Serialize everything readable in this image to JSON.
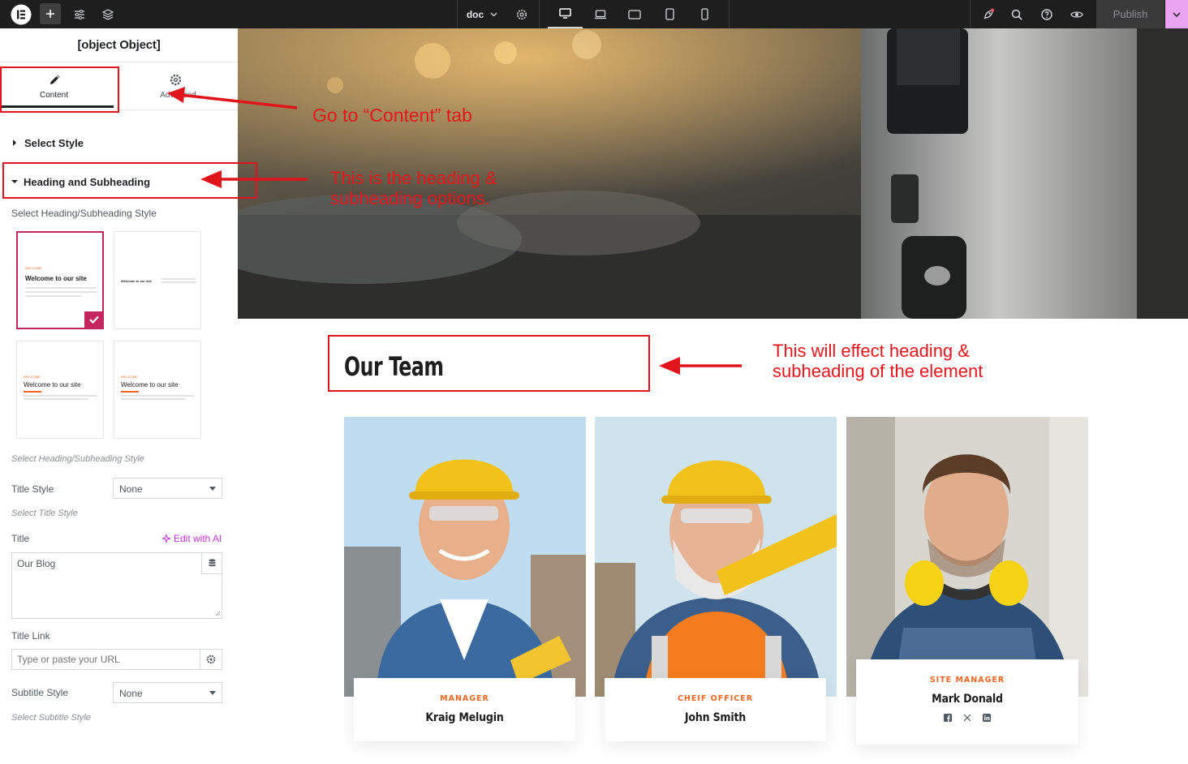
{
  "topbar": {
    "doc_label": "doc",
    "publish_label": "Publish",
    "colors": {
      "bg": "#1e1e1e",
      "publish_dropdown": "#e9a5f2"
    }
  },
  "panel": {
    "title": {
      "label": "Title",
      "edit_ai": "Edit with AI",
      "value": "Our Blog"
    },
    "tabs": [
      {
        "label": "Content",
        "icon": "pencil-icon",
        "active": true
      },
      {
        "label": "Advanced",
        "icon": "gear-icon",
        "active": false
      }
    ],
    "sections": {
      "select_style": "Select Style",
      "heading_subheading": "Heading and Subheading"
    },
    "heading_style_label": "Select Heading/Subheading Style",
    "thumbnails": {
      "sample_subtitle": "WELCOME",
      "sample_title": "Welcome to our site",
      "selected_index": 0
    },
    "heading_style_hint": "Select Heading/Subheading Style",
    "title_style": {
      "label": "Title Style",
      "value": "None",
      "hint": "Select Title Style"
    },
    "title_link": {
      "label": "Title Link",
      "placeholder": "Type or paste your URL"
    },
    "subtitle_style": {
      "label": "Subtitle Style",
      "value": "None",
      "hint": "Select Subtitle Style"
    }
  },
  "annotations": {
    "content_tab": "Go  to “Content” tab",
    "heading_options_line1": "This is the heading &",
    "heading_options_line2": "subheading options.",
    "effect_line1": "This will effect heading &",
    "effect_line2": "subheading of the element",
    "color": "#e8161c"
  },
  "canvas": {
    "section_title": "Our Team",
    "members": [
      {
        "role": "MANAGER",
        "name": "Kraig Melugin"
      },
      {
        "role": "CHEIF OFFICER",
        "name": "John Smith"
      },
      {
        "role": "SITE MANAGER",
        "name": "Mark Donald",
        "socials": [
          "facebook-icon",
          "x-icon",
          "linkedin-icon"
        ]
      }
    ],
    "accent": "#f26522"
  }
}
